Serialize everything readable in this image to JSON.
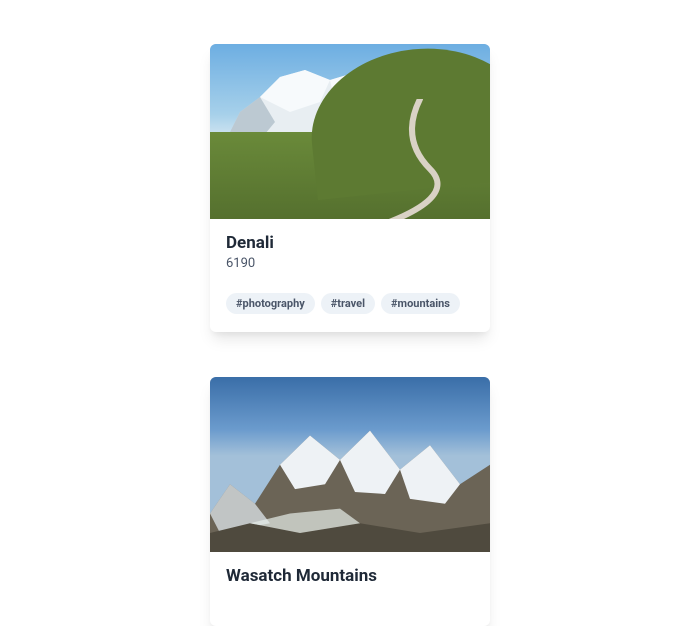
{
  "cards": [
    {
      "title": "Denali",
      "value": "6190",
      "image_alt": "Denali mountain with green tundra foreground and winding road",
      "tags": [
        "#photography",
        "#travel",
        "#mountains"
      ]
    },
    {
      "title": "Wasatch Mountains",
      "value": "",
      "image_alt": "Snow-covered Wasatch mountain range under blue sky",
      "tags": []
    }
  ]
}
